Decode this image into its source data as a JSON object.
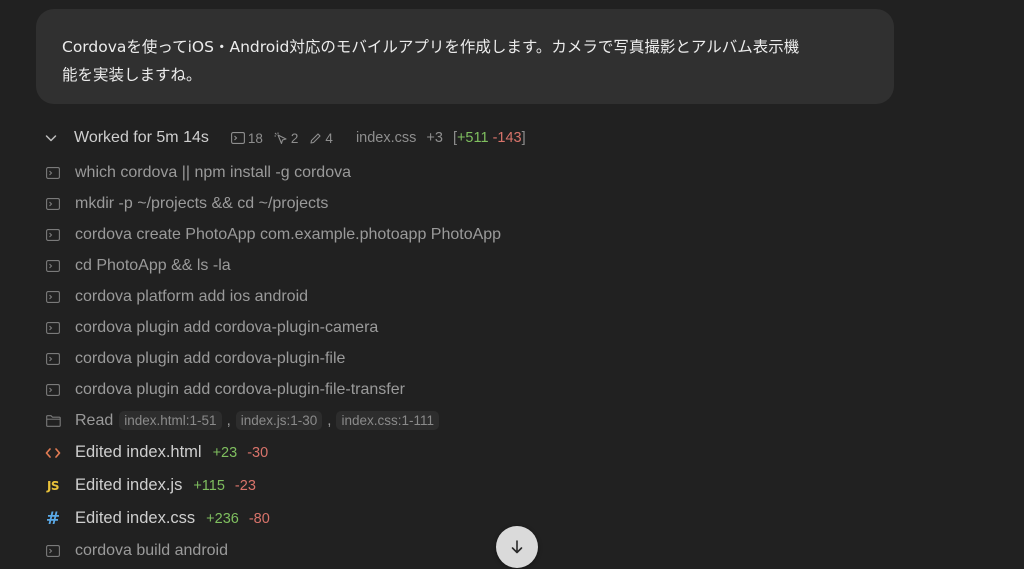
{
  "user_message": {
    "line1": "Cordovaを使ってiOS・Android対応のモバイルアプリを作成します。カメラで写真撮影とアルバム表示機",
    "line2": "能を実装しますね。"
  },
  "worked": {
    "title": "Worked for 5m 14s",
    "terminal_count": "18",
    "click_count": "2",
    "edit_count": "4",
    "file_name": "index.css",
    "file_more": "+3",
    "diff_open": "[",
    "diff_plus": "+511",
    "diff_minus": "-143",
    "diff_close": "]"
  },
  "commands": [
    {
      "icon": "terminal-icon",
      "text": "which cordova || npm install -g cordova"
    },
    {
      "icon": "terminal-icon",
      "text": "mkdir -p ~/projects && cd ~/projects"
    },
    {
      "icon": "terminal-icon",
      "text": "cordova create PhotoApp com.example.photoapp PhotoApp"
    },
    {
      "icon": "terminal-icon",
      "text": "cd PhotoApp && ls -la"
    },
    {
      "icon": "terminal-icon",
      "text": "cordova platform add ios android"
    },
    {
      "icon": "terminal-icon",
      "text": "cordova plugin add cordova-plugin-camera"
    },
    {
      "icon": "terminal-icon",
      "text": "cordova plugin add cordova-plugin-file"
    },
    {
      "icon": "terminal-icon",
      "text": "cordova plugin add cordova-plugin-file-transfer"
    }
  ],
  "read": {
    "label": "Read",
    "chips": [
      "index.html:1-51",
      "index.js:1-30",
      "index.css:1-111"
    ],
    "separator": ","
  },
  "edits": [
    {
      "icon": "html-code-icon",
      "label": "Edited index.html",
      "plus": "+23",
      "minus": "-30"
    },
    {
      "icon": "js-icon",
      "glyph": "JS",
      "label": "Edited index.js",
      "plus": "+115",
      "minus": "-23"
    },
    {
      "icon": "css-hash-icon",
      "glyph": "#",
      "label": "Edited index.css",
      "plus": "+236",
      "minus": "-80"
    }
  ],
  "last_command": {
    "icon": "terminal-icon",
    "text": "cordova build android"
  },
  "colors": {
    "background": "#212121",
    "bubble": "#303030",
    "diff_plus": "#7fbf5f",
    "diff_minus": "#d8736a",
    "js_yellow": "#e8c13a",
    "css_blue": "#5aa9e6",
    "html_orange": "#e07b53"
  }
}
